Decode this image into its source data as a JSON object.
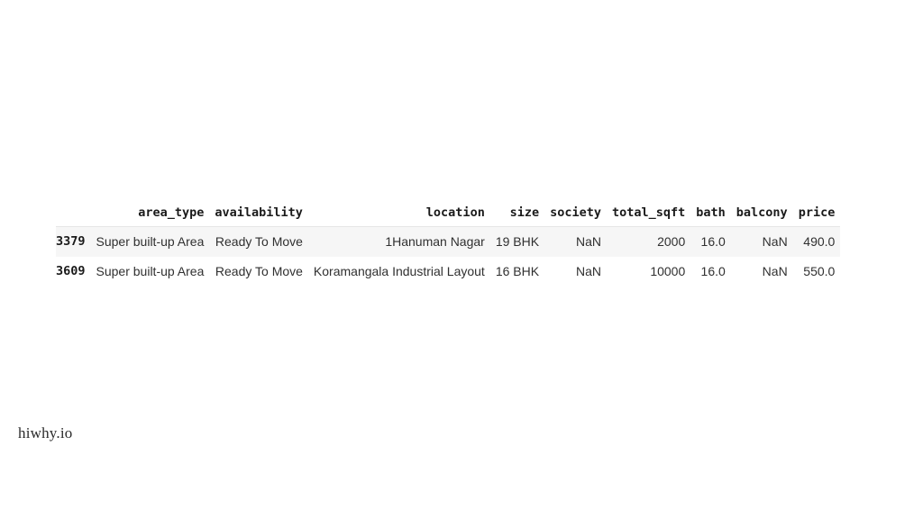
{
  "watermark": {
    "text": "hiwhy.io"
  },
  "dataframe": {
    "index_header": "",
    "columns": [
      "area_type",
      "availability",
      "location",
      "size",
      "society",
      "total_sqft",
      "bath",
      "balcony",
      "price"
    ],
    "rows": [
      {
        "index": "3379",
        "cells": [
          "Super built-up Area",
          "Ready To Move",
          "1Hanuman Nagar",
          "19 BHK",
          "NaN",
          "2000",
          "16.0",
          "NaN",
          "490.0"
        ]
      },
      {
        "index": "3609",
        "cells": [
          "Super built-up Area",
          "Ready To Move",
          "Koramangala Industrial Layout",
          "16 BHK",
          "NaN",
          "10000",
          "16.0",
          "NaN",
          "550.0"
        ]
      }
    ]
  },
  "colors": {
    "page_background": "#ffffff",
    "header_text": "#1a1a1a",
    "cell_text": "#303030",
    "row_stripe": "#f6f6f6",
    "header_rule": "#e6e6e6",
    "watermark_text": "#2b2b2b"
  }
}
